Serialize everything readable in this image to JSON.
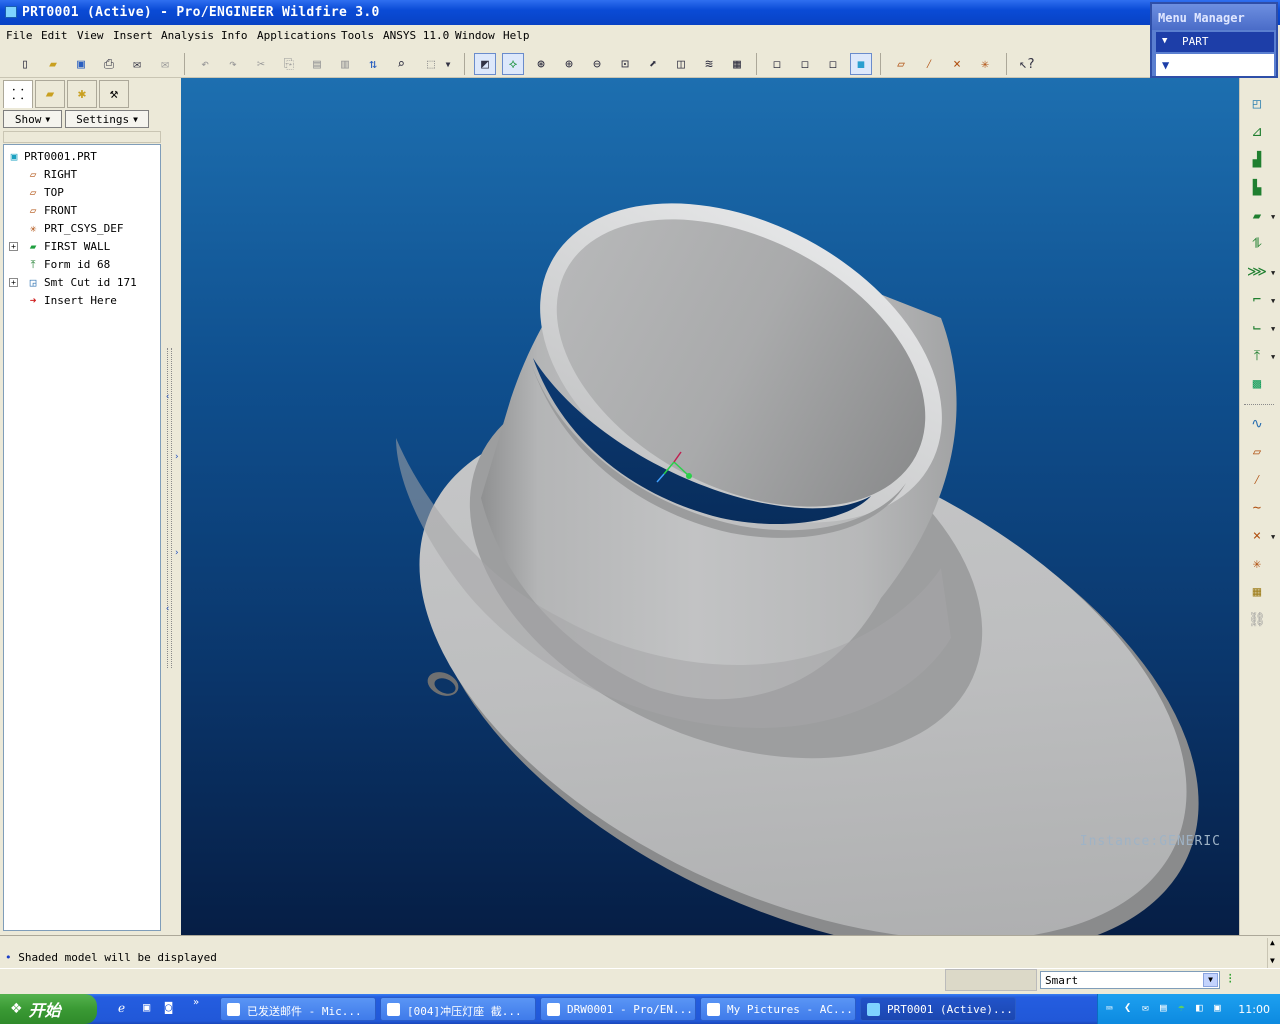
{
  "window": {
    "title": "PRT0001 (Active) - Pro/ENGINEER Wildfire 3.0"
  },
  "menu": [
    "File",
    "Edit",
    "View",
    "Insert",
    "Analysis",
    "Info",
    "Applications",
    "Tools",
    "ANSYS 11.0",
    "Window",
    "Help"
  ],
  "menu_manager": {
    "title": "Menu Manager",
    "item": "PART"
  },
  "left": {
    "show_label": "Show",
    "settings_label": "Settings"
  },
  "tree": [
    {
      "label": "PRT0001.PRT",
      "icon": "part-icon"
    },
    {
      "label": "RIGHT",
      "icon": "datum-plane-icon"
    },
    {
      "label": "TOP",
      "icon": "datum-plane-icon"
    },
    {
      "label": "FRONT",
      "icon": "datum-plane-icon"
    },
    {
      "label": "PRT_CSYS_DEF",
      "icon": "csys-icon"
    },
    {
      "label": "FIRST WALL",
      "icon": "wall-icon"
    },
    {
      "label": "Form id 68",
      "icon": "form-icon"
    },
    {
      "label": "Smt Cut id 171",
      "icon": "cut-icon"
    },
    {
      "label": "Insert Here",
      "icon": "insert-arrow-icon"
    }
  ],
  "viewport": {
    "instance_label": "Instance:GENERIC"
  },
  "message": "Shaded model will be displayed",
  "status": {
    "filter": "Smart"
  },
  "taskbar": {
    "start": "开始",
    "tasks": [
      "已发送邮件 - Mic...",
      "[004]冲压灯座 截...",
      "DRW0001 - Pro/EN...",
      "My Pictures - AC...",
      "PRT0001 (Active)..."
    ],
    "clock": "11:00"
  }
}
